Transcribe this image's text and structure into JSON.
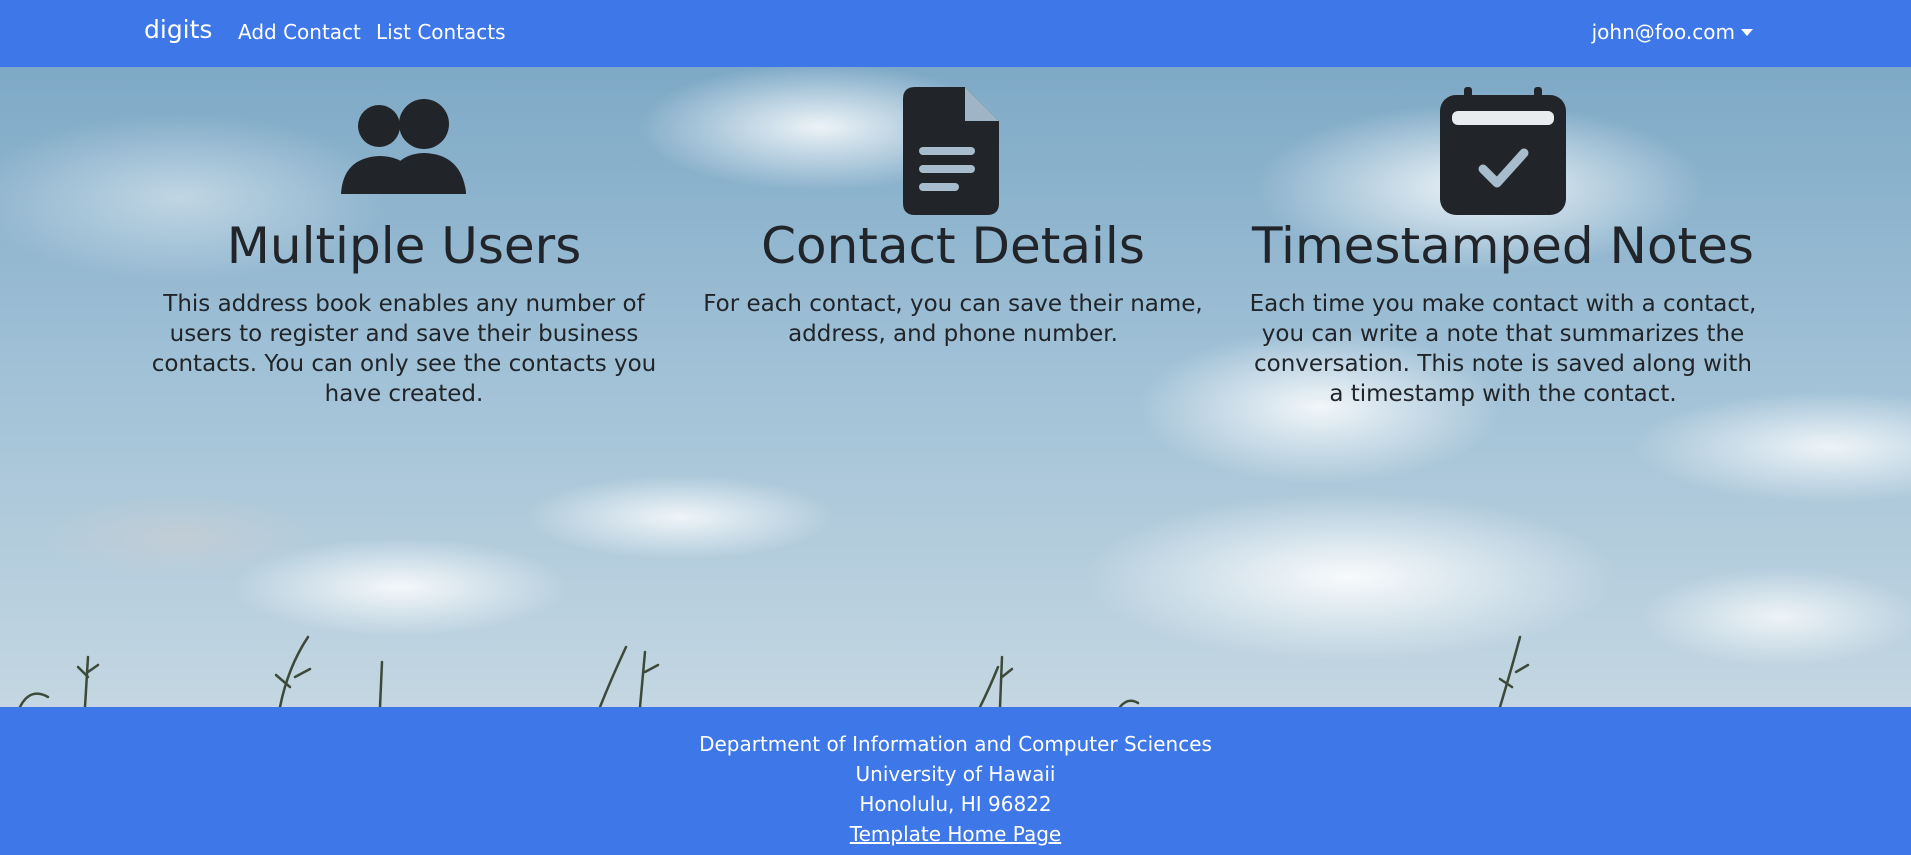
{
  "navbar": {
    "brand": "digits",
    "links": [
      {
        "label": "Add Contact"
      },
      {
        "label": "List Contacts"
      }
    ],
    "user_menu": {
      "label": "john@foo.com",
      "icon": "caret-down-icon"
    },
    "background_color": "#3e77e8"
  },
  "features": [
    {
      "icon": "users-icon",
      "title": "Multiple Users",
      "text": "This address book enables any number of users to register and save their business contacts. You can only see the contacts you have created."
    },
    {
      "icon": "file-icon",
      "title": "Contact Details",
      "text": "For each contact, you can save their name, address, and phone number."
    },
    {
      "icon": "calendar-check-icon",
      "title": "Timestamped Notes",
      "text": "Each time you make contact with a contact, you can write a note that summarizes the conversation. This note is saved along with a timestamp with the contact."
    }
  ],
  "footer": {
    "lines": [
      "Department of Information and Computer Sciences",
      "University of Hawaii",
      "Honolulu, HI 96822"
    ],
    "link_label": "Template Home Page",
    "background_color": "#3e77e8"
  },
  "colors": {
    "text_dark": "#212529",
    "text_light": "#ffffff"
  }
}
